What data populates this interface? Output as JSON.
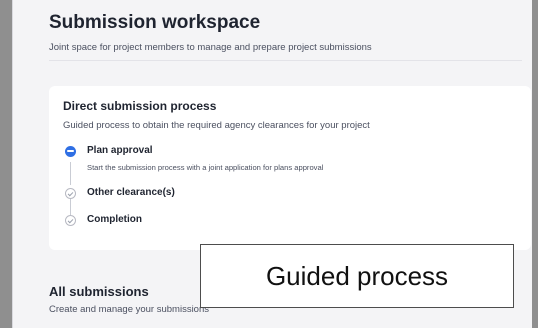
{
  "workspace": {
    "title": "Submission workspace",
    "subtitle": "Joint space for project members to manage and prepare project submissions"
  },
  "direct_process": {
    "title": "Direct submission process",
    "subtitle": "Guided process to obtain the required agency clearances for your project",
    "steps": [
      {
        "label": "Plan approval",
        "description": "Start the submission process with a joint application for plans approval",
        "status": "active",
        "icon": "in-progress-icon"
      },
      {
        "label": "Other clearance(s)",
        "status": "pending",
        "icon": "check-circle-icon"
      },
      {
        "label": "Completion",
        "status": "pending",
        "icon": "check-circle-icon"
      }
    ]
  },
  "all_submissions": {
    "title": "All submissions",
    "subtitle": "Create and manage your submissions"
  },
  "callout": {
    "text": "Guided process"
  },
  "colors": {
    "accent": "#2f6fe4",
    "text_primary": "#1f2430",
    "text_secondary": "#4b5060",
    "panel_bg": "#f4f4f6",
    "card_bg": "#ffffff"
  }
}
